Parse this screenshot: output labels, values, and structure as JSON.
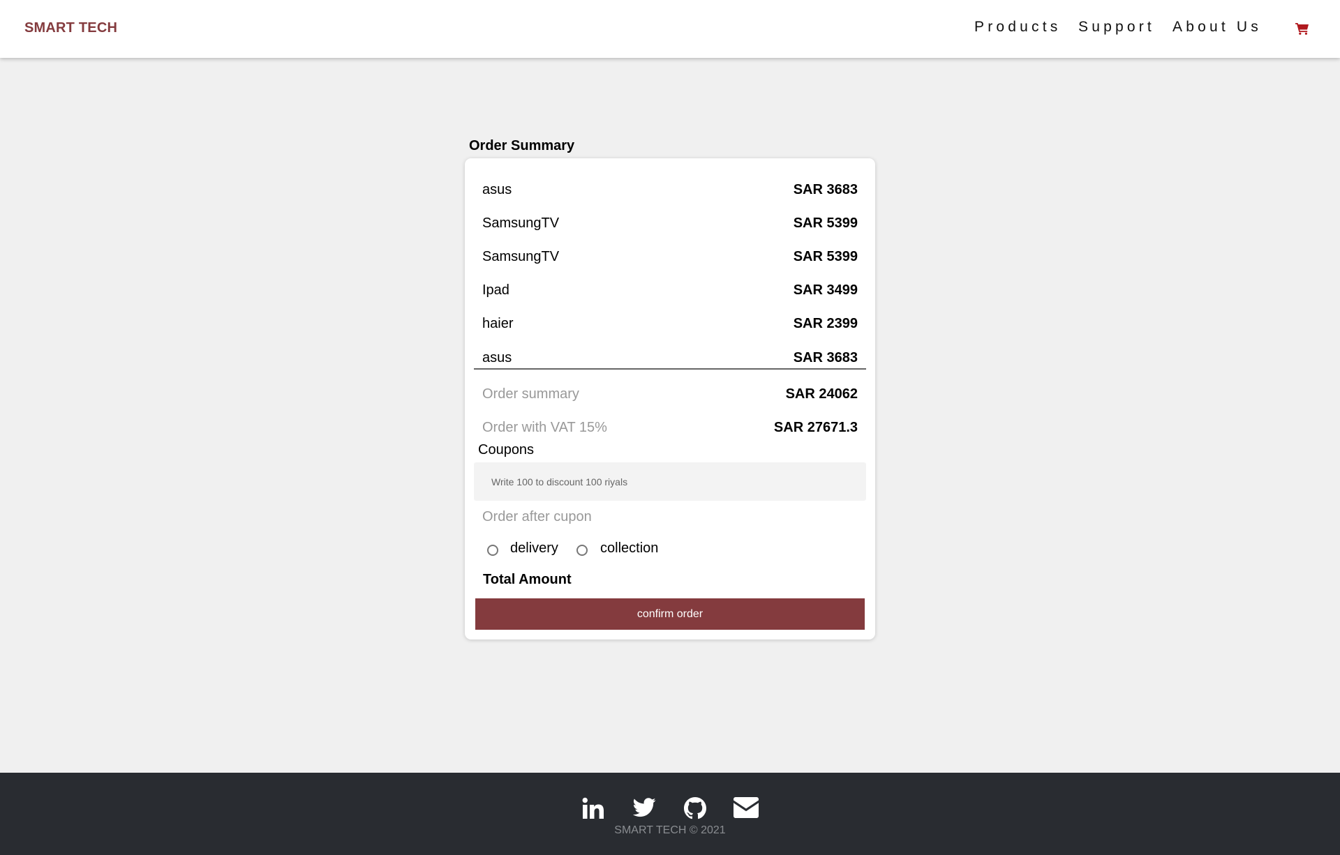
{
  "brand": "SMART TECH",
  "nav": {
    "products": "Products",
    "support": "Support",
    "about": "About Us",
    "cart_icon": "shopping-cart-icon"
  },
  "order": {
    "title": "Order Summary",
    "items": [
      {
        "name": "asus",
        "price": "SAR 3683"
      },
      {
        "name": "SamsungTV",
        "price": "SAR 5399"
      },
      {
        "name": "SamsungTV",
        "price": "SAR 5399"
      },
      {
        "name": "Ipad",
        "price": "SAR 3499"
      },
      {
        "name": "haier",
        "price": "SAR 2399"
      },
      {
        "name": "asus",
        "price": "SAR 3683"
      }
    ],
    "summary_label": "Order summary",
    "summary_value": "SAR 24062",
    "vat_label": "Order with VAT 15%",
    "vat_value": "SAR 27671.3",
    "coupons_label": "Coupons",
    "coupon_placeholder": "Write 100 to discount 100 riyals",
    "after_coupon_label": "Order after cupon",
    "delivery_label": "delivery",
    "collection_label": "collection",
    "total_label": "Total Amount",
    "confirm_label": "confirm order"
  },
  "footer": {
    "icons": [
      "linkedin-icon",
      "twitter-icon",
      "github-icon",
      "envelope-icon"
    ],
    "copyright": "SMART TECH © 2021"
  },
  "colors": {
    "brand": "#843b3e",
    "cart": "#b0191e",
    "footer_bg": "#292c31",
    "page_bg": "#f0f0f0"
  }
}
